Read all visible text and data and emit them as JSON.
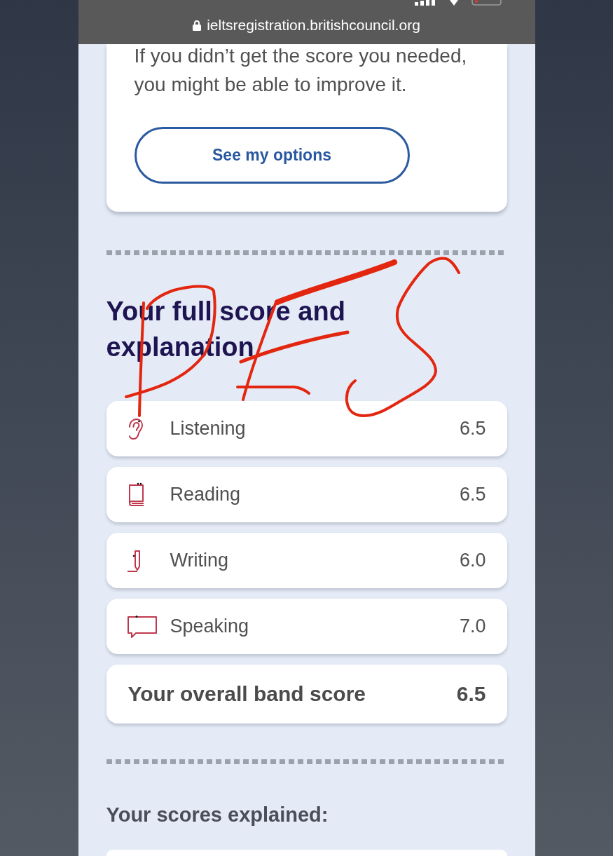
{
  "browser": {
    "secure": true,
    "url": "ieltsregistration.britishcouncil.org"
  },
  "improve_card": {
    "text": "If you didn’t get the score you needed, you might be able to improve it.",
    "button": "See my options"
  },
  "full_score": {
    "heading": "Your full score and explanation",
    "scores": [
      {
        "kind": "listening",
        "label": "Listening",
        "score": "6.5"
      },
      {
        "kind": "reading",
        "label": "Reading",
        "score": "6.5"
      },
      {
        "kind": "writing",
        "label": "Writing",
        "score": "6.0"
      },
      {
        "kind": "speaking",
        "label": "Speaking",
        "score": "7.0"
      }
    ],
    "overall": {
      "label": "Your overall band score",
      "score": "6.5"
    }
  },
  "scores_explained": {
    "heading": "Your scores explained:"
  }
}
